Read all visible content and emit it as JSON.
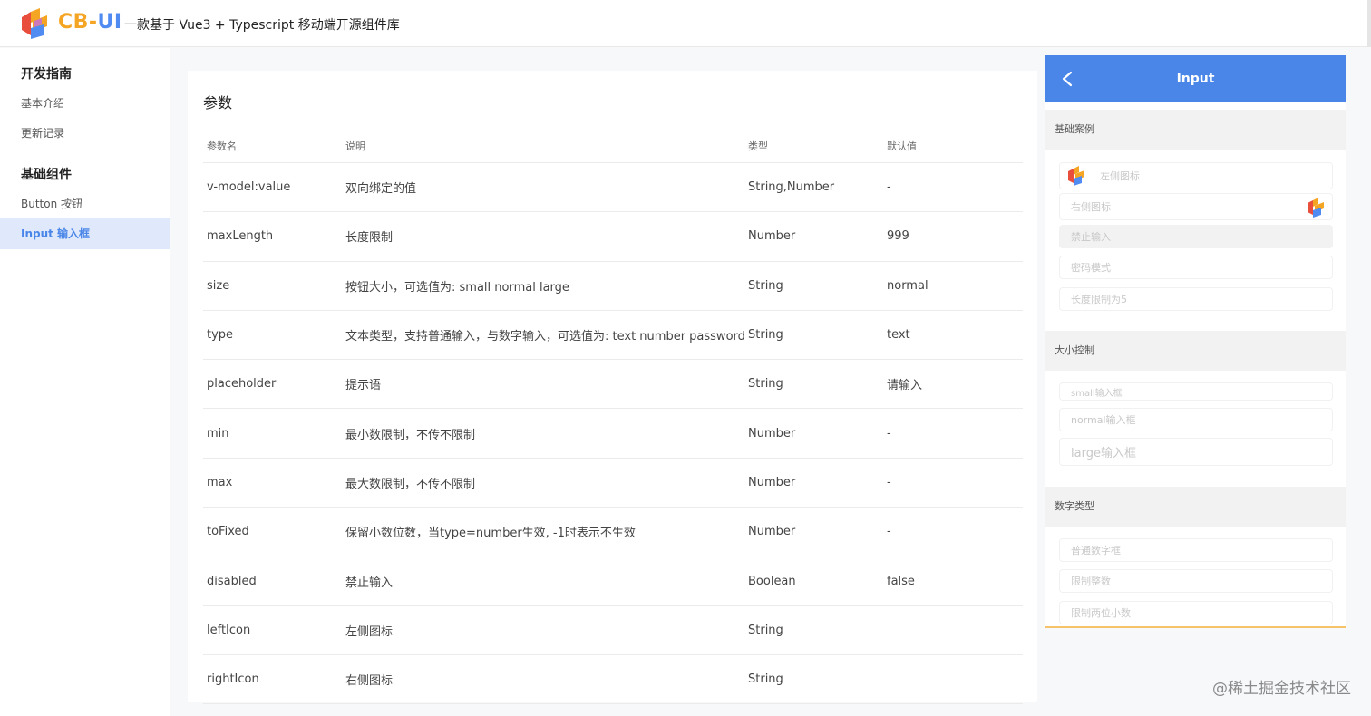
{
  "header": {
    "brand_part1": "CB-",
    "brand_part2": "UI",
    "subtitle": "一款基于 Vue3 + Typescript 移动端开源组件库",
    "logo_icon": "cb-ui-logo-icon",
    "colors": {
      "orange": "#f5a524",
      "blue": "#4f8bf0",
      "red": "#e94e3c"
    }
  },
  "sidebar": {
    "groups": [
      {
        "title": "开发指南",
        "items": [
          {
            "label": "基本介绍"
          },
          {
            "label": "更新记录"
          }
        ]
      },
      {
        "title": "基础组件",
        "items": [
          {
            "label": "Button 按钮"
          },
          {
            "label": "Input 输入框",
            "active": true
          }
        ]
      }
    ]
  },
  "main": {
    "title": "参数",
    "columns": [
      "参数名",
      "说明",
      "类型",
      "默认值"
    ],
    "rows": [
      {
        "name": "v-model:value",
        "desc": "双向绑定的值",
        "type": "String,Number",
        "default": "-"
      },
      {
        "name": "maxLength",
        "desc": "长度限制",
        "type": "Number",
        "default": "999"
      },
      {
        "name": "size",
        "desc": "按钮大小，可选值为: small normal large",
        "type": "String",
        "default": "normal"
      },
      {
        "name": "type",
        "desc": "文本类型，支持普通输入，与数字输入，可选值为: text number password",
        "type": "String",
        "default": "text"
      },
      {
        "name": "placeholder",
        "desc": "提示语",
        "type": "String",
        "default": "请输入"
      },
      {
        "name": "min",
        "desc": "最小数限制，不传不限制",
        "type": "Number",
        "default": "-"
      },
      {
        "name": "max",
        "desc": "最大数限制，不传不限制",
        "type": "Number",
        "default": "-"
      },
      {
        "name": "toFixed",
        "desc": "保留小数位数，当type=number生效, -1时表示不生效",
        "type": "Number",
        "default": "-"
      },
      {
        "name": "disabled",
        "desc": "禁止输入",
        "type": "Boolean",
        "default": "false"
      },
      {
        "name": "leftIcon",
        "desc": "左侧图标",
        "type": "String",
        "default": ""
      },
      {
        "name": "rightIcon",
        "desc": "右侧图标",
        "type": "String",
        "default": ""
      }
    ]
  },
  "phone": {
    "title": "Input",
    "back_icon": "chevron-left-icon",
    "accent": "#4a86e8",
    "sections": {
      "basic": "基础案例",
      "size": "大小控制",
      "number": "数字类型"
    },
    "fields": {
      "left_icon": "左侧图标",
      "right_icon": "右侧图标",
      "disabled": "禁止输入",
      "password": "密码模式",
      "maxlen": "长度限制为5",
      "small": "small输入框",
      "normal": "normal输入框",
      "large": "large输入框",
      "num_plain": "普通数字框",
      "num_int": "限制整数",
      "num_dec": "限制两位小数"
    }
  },
  "watermark": "@稀土掘金技术社区"
}
